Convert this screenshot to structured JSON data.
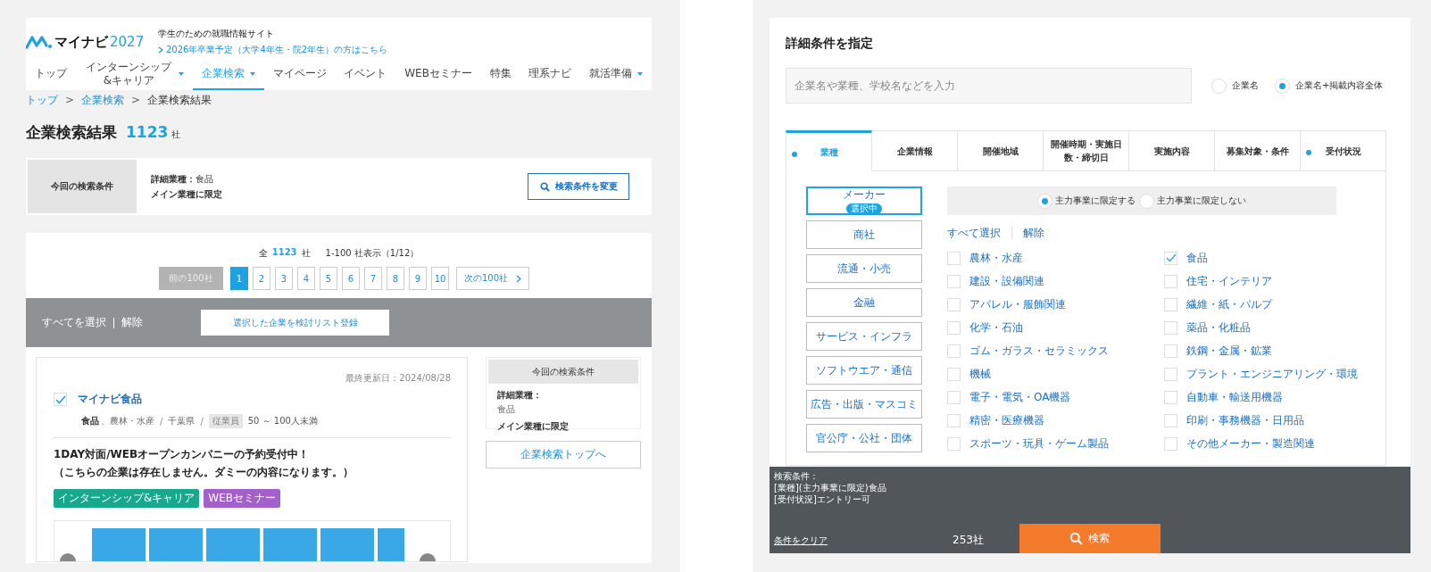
{
  "left": {
    "logo": {
      "name": "マイナビ",
      "year": "2027"
    },
    "tagline": "学生のための就職情報サイト",
    "grad_link": "2026年卒業予定（大学4年生・院2年生）の方はこちら",
    "nav": [
      {
        "label": "トップ",
        "selected": false,
        "dropdown": false
      },
      {
        "label": "インターンシップ&キャリア",
        "selected": false,
        "dropdown": true
      },
      {
        "label": "企業検索",
        "selected": true,
        "dropdown": true
      },
      {
        "label": "マイページ",
        "selected": false,
        "dropdown": false
      },
      {
        "label": "イベント",
        "selected": false,
        "dropdown": false
      },
      {
        "label": "WEBセミナー",
        "selected": false,
        "dropdown": false
      },
      {
        "label": "特集",
        "selected": false,
        "dropdown": false
      },
      {
        "label": "理系ナビ",
        "selected": false,
        "dropdown": false
      },
      {
        "label": "就活準備",
        "selected": false,
        "dropdown": true
      }
    ],
    "breadcrumb": {
      "separator": ">",
      "items": [
        {
          "label": "トップ",
          "link": true
        },
        {
          "label": "企業検索",
          "link": true
        },
        {
          "label": "企業検索結果",
          "link": false
        }
      ]
    },
    "heading": "企業検索結果",
    "count": "1123",
    "count_unit": "社",
    "conditions": {
      "label": "今回の検索条件",
      "lines": [
        "**詳細業種：**食品",
        "**メイン業種に限定**"
      ],
      "button": "検索条件を変更"
    },
    "summary": {
      "prefix": "全",
      "count": "1123",
      "unit": "社",
      "range": "1-100 社表示（1/12）"
    },
    "pagination": {
      "prev": {
        "label": "前の100社",
        "disabled": true
      },
      "next": "次の100社",
      "pages": [
        {
          "label": "1",
          "selected": true
        },
        {
          "label": "2",
          "selected": false
        },
        {
          "label": "3",
          "selected": false
        },
        {
          "label": "4",
          "selected": false
        },
        {
          "label": "5",
          "selected": false
        },
        {
          "label": "6",
          "selected": false
        },
        {
          "label": "7",
          "selected": false
        },
        {
          "label": "8",
          "selected": false
        },
        {
          "label": "9",
          "selected": false
        },
        {
          "label": "10",
          "selected": false
        }
      ]
    },
    "bulk_bar": {
      "select_all": "すべてを選択",
      "clear": "解除",
      "register": "選択した企業を検討リスト登録"
    },
    "company": {
      "updated": "最終更新日：2024/08/28",
      "checked": true,
      "name": "マイナビ食品",
      "meta": [
        {
          "kind": "strong",
          "text": "食品"
        },
        {
          "kind": "text",
          "text": "、農林・水産"
        },
        {
          "kind": "sep",
          "text": "/"
        },
        {
          "kind": "text",
          "text": "千葉県"
        },
        {
          "kind": "sep",
          "text": "/"
        },
        {
          "kind": "badge",
          "text": "従業員"
        },
        {
          "kind": "value",
          "text": "50 ～ 100人未満"
        }
      ],
      "description": [
        "1DAY対面/WEBオープンカンパニーの予約受付中！",
        "（こちらの企業は存在しません。ダミーの内容になります。）"
      ],
      "tags": [
        {
          "label": "インターンシップ&キャリア",
          "color": "#17a88e"
        },
        {
          "label": "WEBセミナー",
          "color": "#a35fcb"
        }
      ]
    },
    "sidebar": {
      "title": "今回の検索条件",
      "label": "詳細業種：",
      "value": "食品",
      "note": "メイン業種に限定",
      "button": "企業検索トップへ"
    }
  },
  "right": {
    "title": "詳細条件を指定",
    "search": {
      "placeholder": "企業名や業種、学校名などを入力"
    },
    "scope": [
      {
        "label": "企業名",
        "selected": false
      },
      {
        "label": "企業名+掲載内容全体",
        "selected": true
      }
    ],
    "tabs": [
      {
        "label": "業種",
        "selected": true,
        "marked": true
      },
      {
        "label": "企業情報",
        "selected": false,
        "marked": false
      },
      {
        "label": "開催地域",
        "selected": false,
        "marked": false
      },
      {
        "label": "開催時期・実施日数・締切日",
        "selected": false,
        "marked": false
      },
      {
        "label": "実施内容",
        "selected": false,
        "marked": false
      },
      {
        "label": "募集対象・条件",
        "selected": false,
        "marked": false
      },
      {
        "label": "受付状況",
        "selected": false,
        "marked": true
      }
    ],
    "categories": [
      {
        "label": "メーカー",
        "selected": true,
        "badge": "選択中"
      },
      {
        "label": "商社",
        "selected": false
      },
      {
        "label": "流通・小売",
        "selected": false
      },
      {
        "label": "金融",
        "selected": false
      },
      {
        "label": "サービス・インフラ",
        "selected": false
      },
      {
        "label": "ソフトウエア・通信",
        "selected": false
      },
      {
        "label": "広告・出版・マスコミ",
        "selected": false
      },
      {
        "label": "官公庁・公社・団体",
        "selected": false
      }
    ],
    "limit": [
      {
        "label": "主力事業に限定する",
        "selected": true
      },
      {
        "label": "主力事業に限定しない",
        "selected": false
      }
    ],
    "select_all": "すべて選択",
    "clear": "解除",
    "industries": [
      {
        "label": "農林・水産",
        "checked": false
      },
      {
        "label": "食品",
        "checked": true
      },
      {
        "label": "建設・設備関連",
        "checked": false
      },
      {
        "label": "住宅・インテリア",
        "checked": false
      },
      {
        "label": "アパレル・服飾関連",
        "checked": false
      },
      {
        "label": "繊維・紙・パルプ",
        "checked": false
      },
      {
        "label": "化学・石油",
        "checked": false
      },
      {
        "label": "薬品・化粧品",
        "checked": false
      },
      {
        "label": "ゴム・ガラス・セラミックス",
        "checked": false
      },
      {
        "label": "鉄鋼・金属・鉱業",
        "checked": false
      },
      {
        "label": "機械",
        "checked": false
      },
      {
        "label": "プラント・エンジニアリング・環境",
        "checked": false
      },
      {
        "label": "電子・電気・OA機器",
        "checked": false
      },
      {
        "label": "自動車・輸送用機器",
        "checked": false
      },
      {
        "label": "精密・医療機器",
        "checked": false
      },
      {
        "label": "印刷・事務機器・日用品",
        "checked": false
      },
      {
        "label": "スポーツ・玩具・ゲーム製品",
        "checked": false
      },
      {
        "label": "その他メーカー・製造関連",
        "checked": false
      }
    ],
    "footer": {
      "label": "検索条件：",
      "lines": [
        "[業種](主力事業に限定)食品",
        "[受付状況]エントリー可"
      ],
      "clear": "条件をクリア",
      "count": "253社",
      "search": "検索"
    }
  }
}
